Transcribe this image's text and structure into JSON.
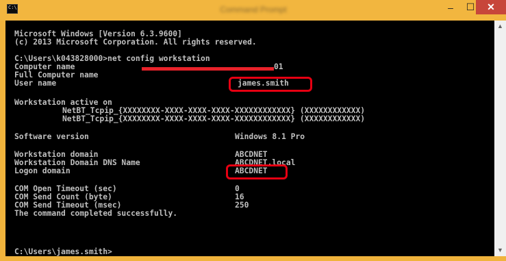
{
  "window": {
    "title": "Command Prompt",
    "icon_label": "C:\\",
    "minimize": "–",
    "maximize": "☐",
    "close": "✕"
  },
  "console": {
    "header1": "Microsoft Windows [Version 6.3.9600]",
    "header2": "(c) 2013 Microsoft Corporation. All rights reserved.",
    "prompt1": "C:\\Users\\k043828000>net config workstation",
    "rows": {
      "computer_name_label": "Computer name",
      "computer_name_value": "01",
      "full_computer_name_label": "Full Computer name",
      "user_name_label": "User name",
      "user_name_value": "james.smith",
      "ws_active_label": "Workstation active on",
      "netbt1": "NetBT_Tcpip_{XXXXXXXX-XXXX-XXXX-XXXX-XXXXXXXXXXXX} (XXXXXXXXXXXX)",
      "netbt2": "NetBT_Tcpip_{XXXXXXXX-XXXX-XXXX-XXXX-XXXXXXXXXXXX} (XXXXXXXXXXXX)",
      "software_version_label": "Software version",
      "software_version_value": "Windows 8.1 Pro",
      "ws_domain_label": "Workstation domain",
      "ws_domain_value": "ABCDNET",
      "ws_dns_label": "Workstation Domain DNS Name",
      "ws_dns_value": "ABCDNET.local",
      "logon_domain_label": "Logon domain",
      "logon_domain_value": "ABCDNET",
      "com_open_label": "COM Open Timeout (sec)",
      "com_open_value": "0",
      "com_send_count_label": "COM Send Count (byte)",
      "com_send_count_value": "16",
      "com_send_timeout_label": "COM Send Timeout (msec)",
      "com_send_timeout_value": "250",
      "completed": "The command completed successfully."
    },
    "prompt2": "C:\\Users\\james.smith>"
  },
  "scrollbar": {
    "up": "▲",
    "down": "▼"
  },
  "colors": {
    "frame": "#f0b33c",
    "close": "#c7463a",
    "console_bg": "#000000",
    "console_text": "#c0c0c0",
    "highlight": "#e60012"
  }
}
